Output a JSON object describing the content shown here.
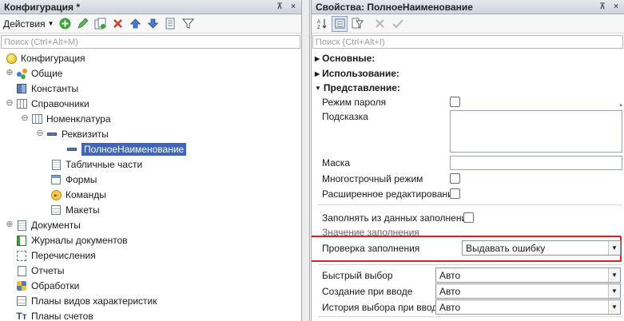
{
  "left_panel": {
    "title": "Конфигурация *",
    "pin_glyph": "⊼",
    "close_glyph": "×",
    "actions_label": "Действия",
    "toolbar_icons": [
      "add-icon",
      "edit-icon",
      "copy-icon",
      "delete-icon",
      "move-up-icon",
      "move-down-icon",
      "list-icon",
      "filter-icon"
    ],
    "search_placeholder": "Поиск (Ctrl+Alt+M)",
    "tree": [
      {
        "label": "Конфигурация",
        "icon": "configuration-icon",
        "expander": ""
      },
      {
        "label": "Общие",
        "icon": "common-icon",
        "expander": "⊕"
      },
      {
        "label": "Константы",
        "icon": "constants-icon",
        "expander": ""
      },
      {
        "label": "Справочники",
        "icon": "catalogs-icon",
        "expander": "⊖"
      },
      {
        "label": "Номенклатура",
        "icon": "catalog-icon",
        "expander": "⊖"
      },
      {
        "label": "Реквизиты",
        "icon": "attributes-icon",
        "expander": "⊖"
      },
      {
        "label": "ПолноеНаименование",
        "icon": "attribute-icon",
        "expander": "",
        "selected": true
      },
      {
        "label": "Табличные части",
        "icon": "tabular-sections-icon",
        "expander": ""
      },
      {
        "label": "Формы",
        "icon": "forms-icon",
        "expander": ""
      },
      {
        "label": "Команды",
        "icon": "commands-icon",
        "expander": ""
      },
      {
        "label": "Макеты",
        "icon": "templates-icon",
        "expander": ""
      },
      {
        "label": "Документы",
        "icon": "documents-icon",
        "expander": "⊕"
      },
      {
        "label": "Журналы документов",
        "icon": "journals-icon",
        "expander": ""
      },
      {
        "label": "Перечисления",
        "icon": "enums-icon",
        "expander": ""
      },
      {
        "label": "Отчеты",
        "icon": "reports-icon",
        "expander": ""
      },
      {
        "label": "Обработки",
        "icon": "processing-icon",
        "expander": ""
      },
      {
        "label": "Планы видов характеристик",
        "icon": "char-types-icon",
        "expander": ""
      },
      {
        "label": "Планы счетов",
        "icon": "accounts-icon",
        "expander": ""
      }
    ]
  },
  "right_panel": {
    "title": "Свойства: ПолноеНаименование",
    "pin_glyph": "⊼",
    "close_glyph": "×",
    "toolbar_icons": [
      "sort-alpha-icon",
      "categories-icon",
      "filter-icon",
      "clear-icon",
      "apply-icon"
    ],
    "search_placeholder": "Поиск (Ctrl+Alt+I)",
    "groups": {
      "basic": "Основные:",
      "usage": "Использование:",
      "presentation": "Представление:"
    },
    "properties": {
      "password_mode": {
        "label": "Режим пароля",
        "checked": false
      },
      "tooltip": {
        "label": "Подсказка",
        "value": ""
      },
      "mask": {
        "label": "Маска",
        "value": ""
      },
      "multiline": {
        "label": "Многострочный режим",
        "checked": false
      },
      "extended_edit": {
        "label": "Расширенное редактирование",
        "checked": false
      },
      "fill_from_data": {
        "label": "Заполнять из данных заполнения",
        "checked": false
      },
      "fill_value": {
        "label": "Значение заполнения",
        "value": ""
      },
      "fill_check": {
        "label": "Проверка заполнения",
        "value": "Выдавать ошибку"
      },
      "quick_choice": {
        "label": "Быстрый выбор",
        "value": "Авто"
      },
      "create_on_input": {
        "label": "Создание при вводе",
        "value": "Авто"
      },
      "choice_history": {
        "label": "История выбора при вводе",
        "value": "Авто"
      }
    },
    "highlight_color": "#e02020",
    "selection_color": "#3f66b8"
  }
}
